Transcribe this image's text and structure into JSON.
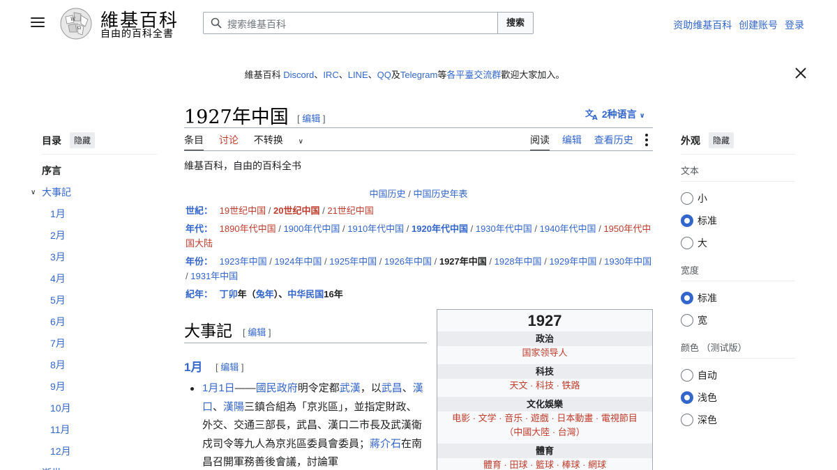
{
  "header": {
    "wordmark": "維基百科",
    "tagline": "自由的百科全書",
    "search_placeholder": "搜索维基百科",
    "search_button": "搜索",
    "user_links": [
      "资助维基百科",
      "创建账号",
      "登录"
    ]
  },
  "banner": {
    "pre": "維基百科 ",
    "links": [
      "Discord",
      "IRC",
      "LINE",
      "QQ",
      "Telegram"
    ],
    "sep1": "、",
    "sep_and": "及",
    "mid": "等",
    "link2": "各平臺交流群",
    "post": "歡迎大家加入。"
  },
  "toc": {
    "title": "目录",
    "hide": "隐藏",
    "items": [
      "序言",
      "大事記",
      "1月",
      "2月",
      "3月",
      "4月",
      "5月",
      "6月",
      "7月",
      "8月",
      "9月",
      "10月",
      "11月",
      "12月",
      "逝世"
    ]
  },
  "article": {
    "title": "1927年中国",
    "edit": "编辑",
    "languages": "2种语言",
    "tabs_left": [
      "条目",
      "讨论",
      "不转换"
    ],
    "tabs_right": [
      "阅读",
      "编辑",
      "查看历史"
    ],
    "from": "維基百科，自由的百科全书",
    "nav_center": [
      "中国历史",
      "中国历史年表"
    ],
    "century_label": "世紀",
    "centuries": [
      "19世纪中国",
      "20世纪中国",
      "21世纪中国"
    ],
    "decade_label": "年代",
    "decades": [
      "1890年代中国",
      "1900年代中国",
      "1910年代中国",
      "1920年代中国",
      "1930年代中国",
      "1940年代中国",
      "1950年代中国大陆"
    ],
    "year_label": "年份",
    "years": [
      "1923年中国",
      "1924年中国",
      "1925年中国",
      "1926年中国",
      "1927年中国",
      "1928年中国",
      "1929年中国",
      "1930年中国",
      "1931年中国"
    ],
    "era_label": "紀年",
    "era": [
      "丁卯",
      "年（",
      "兔年",
      "）、",
      "中华民国",
      "16年"
    ],
    "h2": "大事記",
    "h3": "1月",
    "bullet_parts": [
      "1月1日",
      "——",
      "國民政府",
      "明令定都",
      "武漢",
      "，以",
      "武昌",
      "、",
      "漢口",
      "、",
      "漢陽",
      "三鎮合組為「京兆區」，並指定財政、外交、交通三部長，武昌、漢口二市長及武漢衛戍司令等九人為京兆區委員會委員；",
      "蔣介石",
      "在南昌召開軍務善後會議，討論軍"
    ]
  },
  "infobox": {
    "title": "1927",
    "sections": [
      {
        "head": "政治",
        "rows": [
          "国家领导人"
        ]
      },
      {
        "head": "科技",
        "rows": [
          "天文 · 科技 · 铁路"
        ]
      },
      {
        "head": "文化娛樂",
        "rows": [
          "电影 · 文学 · 音乐 · 遊戲 · 日本動畫 · 電視節目",
          "（中國大陸 · 台灣）"
        ]
      },
      {
        "head": "體育",
        "rows": [
          "體育 · 田球 · 籃球 · 棒球 · 網球"
        ]
      }
    ]
  },
  "appearance": {
    "title": "外观",
    "hide": "隐藏",
    "text_label": "文本",
    "text_options": [
      "小",
      "标准",
      "大"
    ],
    "width_label": "宽度",
    "width_options": [
      "标准",
      "宽"
    ],
    "color_label": "颜色 （测试版）",
    "color_options": [
      "自动",
      "浅色",
      "深色"
    ],
    "selected": {
      "text": "标准",
      "width": "标准",
      "color": "浅色"
    }
  },
  "colors": {
    "link": "#3366cc",
    "redlink": "#bf3c2c",
    "text": "#202122",
    "accent": "#3366cc"
  }
}
